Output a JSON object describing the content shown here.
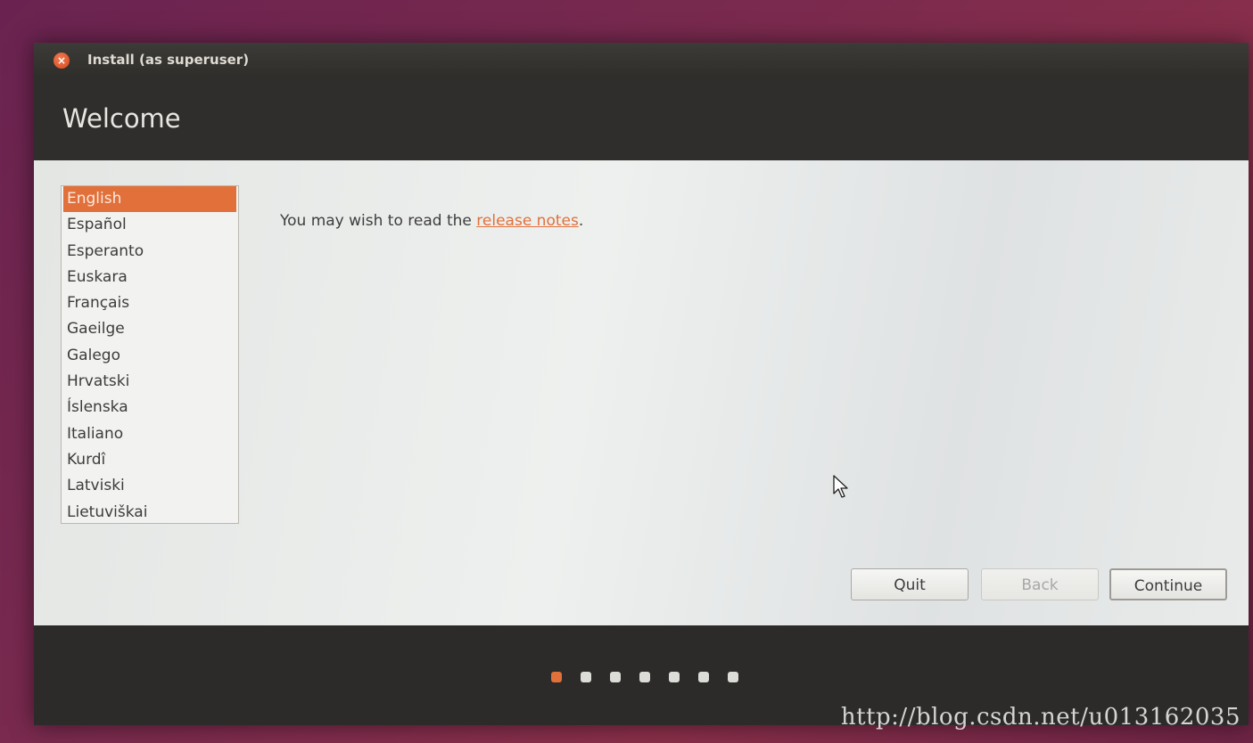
{
  "window": {
    "title": "Install (as superuser)",
    "close_icon": "close-icon"
  },
  "header": {
    "title": "Welcome"
  },
  "languages": {
    "selected": "English",
    "items": [
      "English",
      "Español",
      "Esperanto",
      "Euskara",
      "Français",
      "Gaeilge",
      "Galego",
      "Hrvatski",
      "Íslenska",
      "Italiano",
      "Kurdî",
      "Latviski",
      "Lietuviškai"
    ]
  },
  "main": {
    "release_prefix": "You may wish to read the ",
    "release_link": "release notes",
    "release_suffix": "."
  },
  "buttons": {
    "quit": "Quit",
    "back": "Back",
    "continue": "Continue"
  },
  "progress": {
    "total_steps": 7,
    "current_step": 1
  },
  "colors": {
    "accent": "#e2703a",
    "header_bg": "#2f2e2c",
    "content_bg": "#eceeed"
  },
  "watermark": "http://blog.csdn.net/u013162035"
}
